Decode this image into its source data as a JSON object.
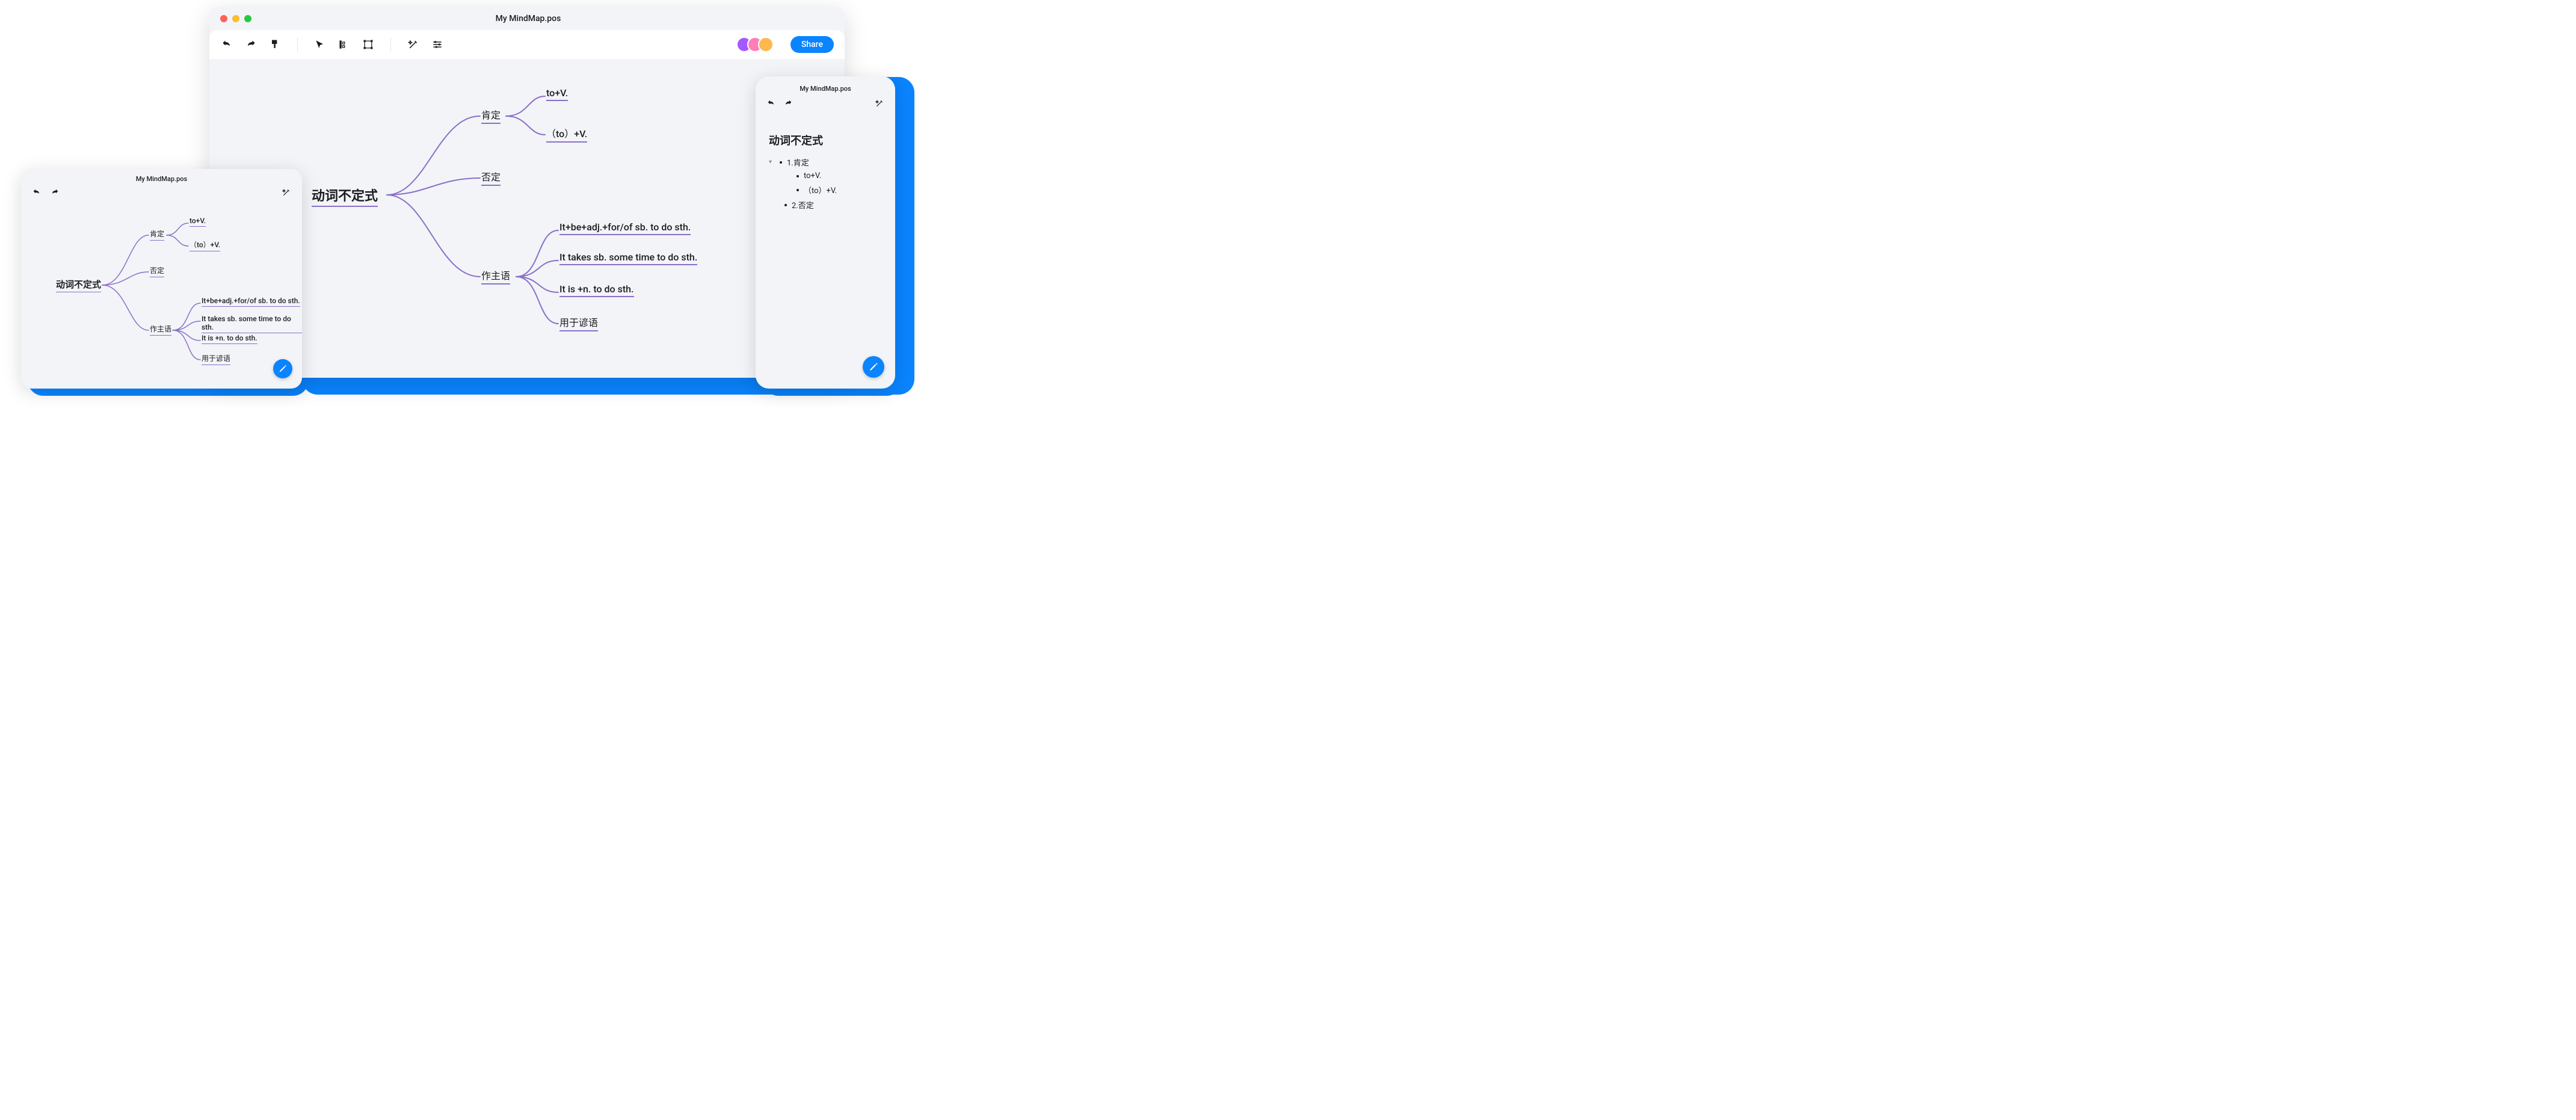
{
  "file_name": "My MindMap.pos",
  "colors": {
    "accent": "#0a84ff",
    "line": "#8b6fc7",
    "canvas_bg": "#f2f4f8"
  },
  "toolbar": {
    "undo": "undo",
    "redo": "redo",
    "format_painter": "format-painter",
    "cursor": "cursor",
    "align": "align",
    "transform": "transform",
    "magic": "auto-layout",
    "settings": "settings-sliders",
    "share_label": "Share"
  },
  "avatars": [
    {
      "bg": "#a259ff"
    },
    {
      "bg": "#ff7eb6"
    },
    {
      "bg": "#ffb84d"
    }
  ],
  "mindmap": {
    "root": "动词不定式",
    "branches": [
      {
        "label": "肯定",
        "children": [
          "to+V.",
          "（to）+V."
        ]
      },
      {
        "label": "否定",
        "children": []
      },
      {
        "label": "作主语",
        "children": [
          "It+be+adj.+for/of sb. to do sth.",
          "It takes sb. some time to do sth.",
          "It is +n. to do sth.",
          "用于谚语"
        ]
      }
    ]
  },
  "outline": {
    "title": "动词不定式",
    "items": [
      {
        "label": "1.肯定",
        "expanded": true,
        "children": [
          "to+V.",
          "（to）+V."
        ]
      },
      {
        "label": "2.否定",
        "expanded": false,
        "children": []
      }
    ]
  },
  "view_controls": {
    "visibility": "eye",
    "focus": "focus",
    "zoom": "zoom-in"
  }
}
